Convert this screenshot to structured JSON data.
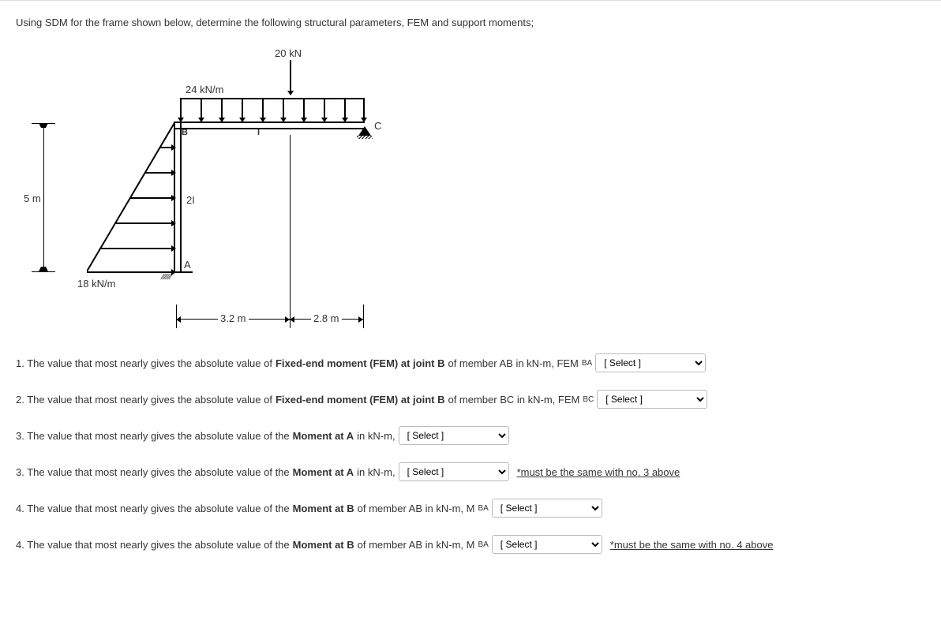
{
  "intro": "Using SDM for the frame shown below, determine the following structural parameters, FEM and support moments;",
  "diagram": {
    "point_load": "20 kN",
    "dist_load_top": "24 kN/m",
    "dist_load_side": "18 kN/m",
    "height": "5 m",
    "span_left": "3.2 m",
    "span_right": "2.8 m",
    "label_B": "B",
    "label_C": "C",
    "label_A": "A",
    "label_2I": "2I",
    "label_I": "I"
  },
  "q1": {
    "prefix": "1. The value that most nearly gives the absolute value of ",
    "bold": "Fixed-end moment (FEM) at joint B",
    "suffix": " of member AB in kN-m, FEM",
    "sub": "BA"
  },
  "q2": {
    "prefix": "2. The value that most nearly gives the absolute value of ",
    "bold": "Fixed-end moment (FEM) at joint B",
    "suffix": " of member BC in kN-m, FEM",
    "sub": "BC"
  },
  "q3": {
    "prefix": "3. The value that most nearly gives the absolute value of the ",
    "bold": "Moment at A",
    "suffix": " in kN-m,"
  },
  "q3b": {
    "prefix": "3.  The value that most nearly gives the absolute value of the ",
    "bold": "Moment at A",
    "suffix": " in kN-m,",
    "note": "*must be the same with no. 3 above"
  },
  "q4": {
    "prefix": "4. The value that most nearly gives the absolute value of the ",
    "bold": "Moment at B",
    "suffix": " of member AB in kN-m, M",
    "sub": "BA"
  },
  "q4b": {
    "prefix": "4. The value that most nearly gives the absolute value of the ",
    "bold": "Moment at B",
    "suffix": " of member AB in kN-m, M",
    "sub": "BA",
    "note": "*must be the same with no. 4 above"
  },
  "select_placeholder": "[ Select ]"
}
